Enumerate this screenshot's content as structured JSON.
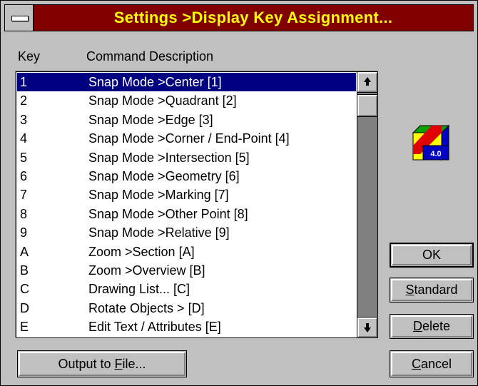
{
  "window": {
    "title": "Settings >Display Key Assignment..."
  },
  "columns": {
    "key": "Key",
    "description": "Command Description"
  },
  "list": {
    "selected_index": 0,
    "rows": [
      {
        "key": "1",
        "desc": "Snap Mode >Center [1]"
      },
      {
        "key": "2",
        "desc": "Snap Mode >Quadrant [2]"
      },
      {
        "key": "3",
        "desc": "Snap Mode >Edge [3]"
      },
      {
        "key": "4",
        "desc": "Snap Mode >Corner / End-Point [4]"
      },
      {
        "key": "5",
        "desc": "Snap Mode >Intersection [5]"
      },
      {
        "key": "6",
        "desc": "Snap Mode >Geometry [6]"
      },
      {
        "key": "7",
        "desc": "Snap Mode >Marking [7]"
      },
      {
        "key": "8",
        "desc": "Snap Mode >Other Point [8]"
      },
      {
        "key": "9",
        "desc": "Snap Mode >Relative [9]"
      },
      {
        "key": "A",
        "desc": "Zoom >Section [A]"
      },
      {
        "key": "B",
        "desc": "Zoom >Overview [B]"
      },
      {
        "key": "C",
        "desc": "Drawing List... [C]"
      },
      {
        "key": "D",
        "desc": "Rotate Objects > [D]"
      },
      {
        "key": "E",
        "desc": "Edit Text / Attributes [E]"
      }
    ]
  },
  "logo": {
    "version": "4.0",
    "icon": "app-version-logo"
  },
  "buttons": {
    "ok": "OK",
    "standard_mnemonic": "S",
    "standard_rest": "tandard",
    "delete_mnemonic": "D",
    "delete_rest": "elete",
    "cancel_mnemonic": "C",
    "cancel_rest": "ancel",
    "output_prefix": "Output to ",
    "output_mnemonic": "F",
    "output_rest": "ile..."
  },
  "colors": {
    "title_bg": "#800000",
    "title_text": "#ffff00",
    "selection": "#000080",
    "face": "#c0c0c0"
  }
}
